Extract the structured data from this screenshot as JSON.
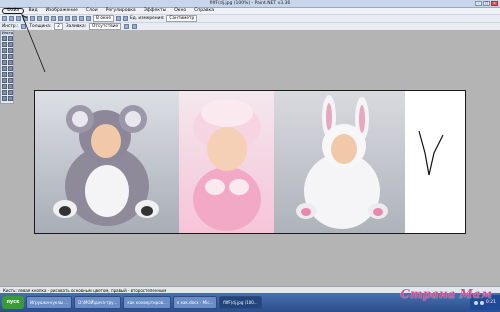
{
  "window": {
    "title": "fIIfF(dj.jpg (100%) - Paint.NET v3.36"
  },
  "menu": {
    "items": [
      "Файл",
      "Вид",
      "Изображение",
      "Слои",
      "Регулировка",
      "Эффекты",
      "Окно",
      "Справка"
    ]
  },
  "toolbar": {
    "zoom_label": "В окне",
    "units_label": "Ед. измерения:",
    "units_value": "Сантиметр",
    "instrument_label": "Инстр.:",
    "width_label": "Толщина:",
    "width_value": "2",
    "fill_label": "Заливка:",
    "fill_value": "Отсутствие"
  },
  "tools_panel": {
    "title": "Инстр. ×"
  },
  "status": {
    "text": "Кисть: левая кнопка - рисовать основным цветом, правый - второстепенным"
  },
  "taskbar": {
    "start": "пуск",
    "tasks": [
      "Игрушки-куклы ...",
      "D:\\МОЙ\\доча-тру...",
      "как конвертиров...",
      "к как.docx - Mic...",
      "fIIfF(dj.jpg (100..."
    ],
    "time": "0:21"
  },
  "watermark": "Страна Мам",
  "drawing": {
    "glyph": "V"
  }
}
